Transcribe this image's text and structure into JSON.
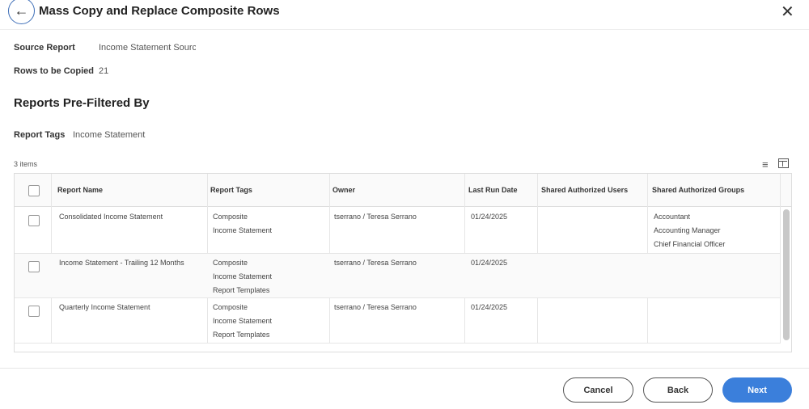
{
  "header": {
    "title": "Mass Copy and Replace Composite Rows",
    "back_icon": "arrow-left-icon",
    "close_icon": "close-icon"
  },
  "fields": {
    "source_report_label": "Source Report",
    "source_report_value": "Income Statement Sourc",
    "rows_label": "Rows to be Copied",
    "rows_value": "21"
  },
  "section": {
    "title": "Reports Pre-Filtered By",
    "tags_label": "Report Tags",
    "tags_value": "Income Statement"
  },
  "table": {
    "count": "3 items",
    "columns": [
      "Report Name",
      "Report Tags",
      "Owner",
      "Last Run Date",
      "Shared Authorized Users",
      "Shared Authorized Groups"
    ],
    "rows": [
      {
        "name": "Consolidated Income Statement",
        "tags": [
          "Composite",
          "Income Statement"
        ],
        "owner": "tserrano / Teresa Serrano",
        "date": "01/24/2025",
        "groups": [
          "Accountant",
          "Accounting Manager",
          "Chief Financial Officer"
        ]
      },
      {
        "name": "Income Statement - Trailing 12 Months",
        "tags": [
          "Composite",
          "Income Statement",
          "Report Templates"
        ],
        "owner": "tserrano / Teresa Serrano",
        "date": "01/24/2025",
        "groups": []
      },
      {
        "name": "Quarterly Income Statement",
        "tags": [
          "Composite",
          "Income Statement",
          "Report Templates"
        ],
        "owner": "tserrano / Teresa Serrano",
        "date": "01/24/2025",
        "groups": []
      }
    ]
  },
  "footer": {
    "cancel": "Cancel",
    "back": "Back",
    "next": "Next"
  },
  "colors": {
    "primary": "#3b7fdb"
  }
}
